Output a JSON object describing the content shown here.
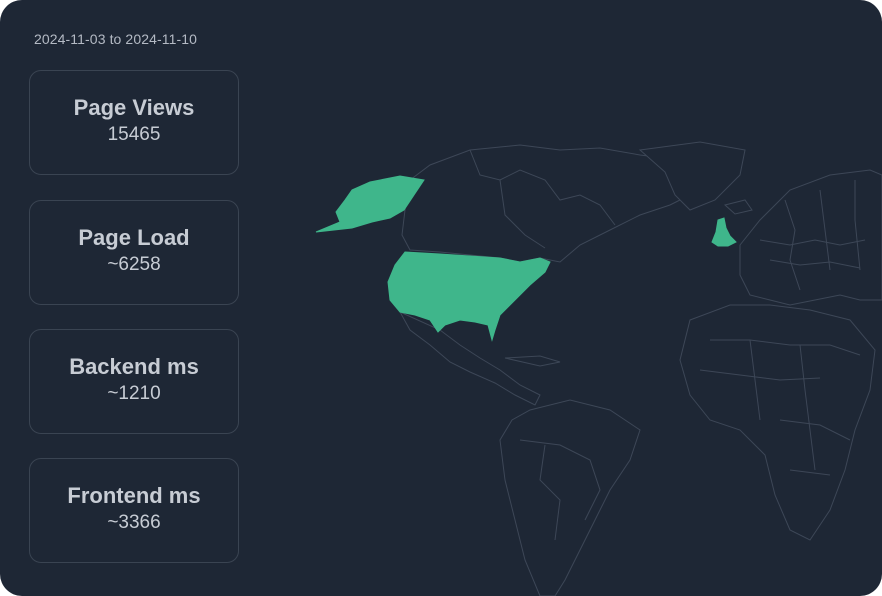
{
  "date_range": "2024-11-03 to 2024-11-10",
  "metrics": [
    {
      "title": "Page Views",
      "value": "15465"
    },
    {
      "title": "Page Load",
      "value": "~6258"
    },
    {
      "title": "Backend ms",
      "value": "~1210"
    },
    {
      "title": "Frontend ms",
      "value": "~3366"
    }
  ],
  "map": {
    "highlighted_regions": [
      "united-states",
      "alaska",
      "united-kingdom"
    ],
    "highlight_color": "#3fb68b",
    "background_color": "#1e2735",
    "border_color": "#3d4757"
  }
}
